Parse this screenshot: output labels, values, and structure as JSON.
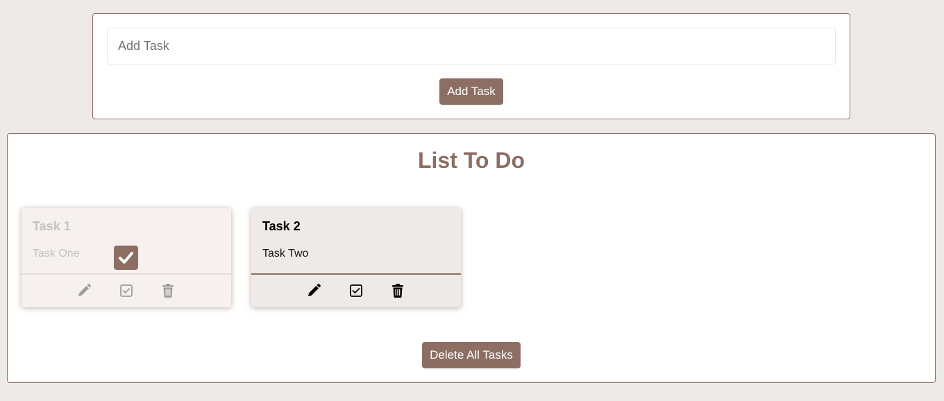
{
  "add_task": {
    "placeholder": "Add Task",
    "value": "",
    "button_label": "Add Task"
  },
  "list": {
    "title": "List To Do",
    "delete_all_label": "Delete All Tasks"
  },
  "tasks": [
    {
      "title": "Task 1",
      "description": "Task One",
      "completed": true
    },
    {
      "title": "Task 2",
      "description": "Task Two",
      "completed": false
    }
  ],
  "icons": {
    "edit": "pencil-icon",
    "complete": "check-square-icon",
    "delete": "trash-icon",
    "done": "checkmark-icon"
  },
  "colors": {
    "accent": "#8d6e63",
    "background": "#eeeae7",
    "completed_text": "#c6c2c0",
    "completed_icon": "#9e9e9e"
  }
}
